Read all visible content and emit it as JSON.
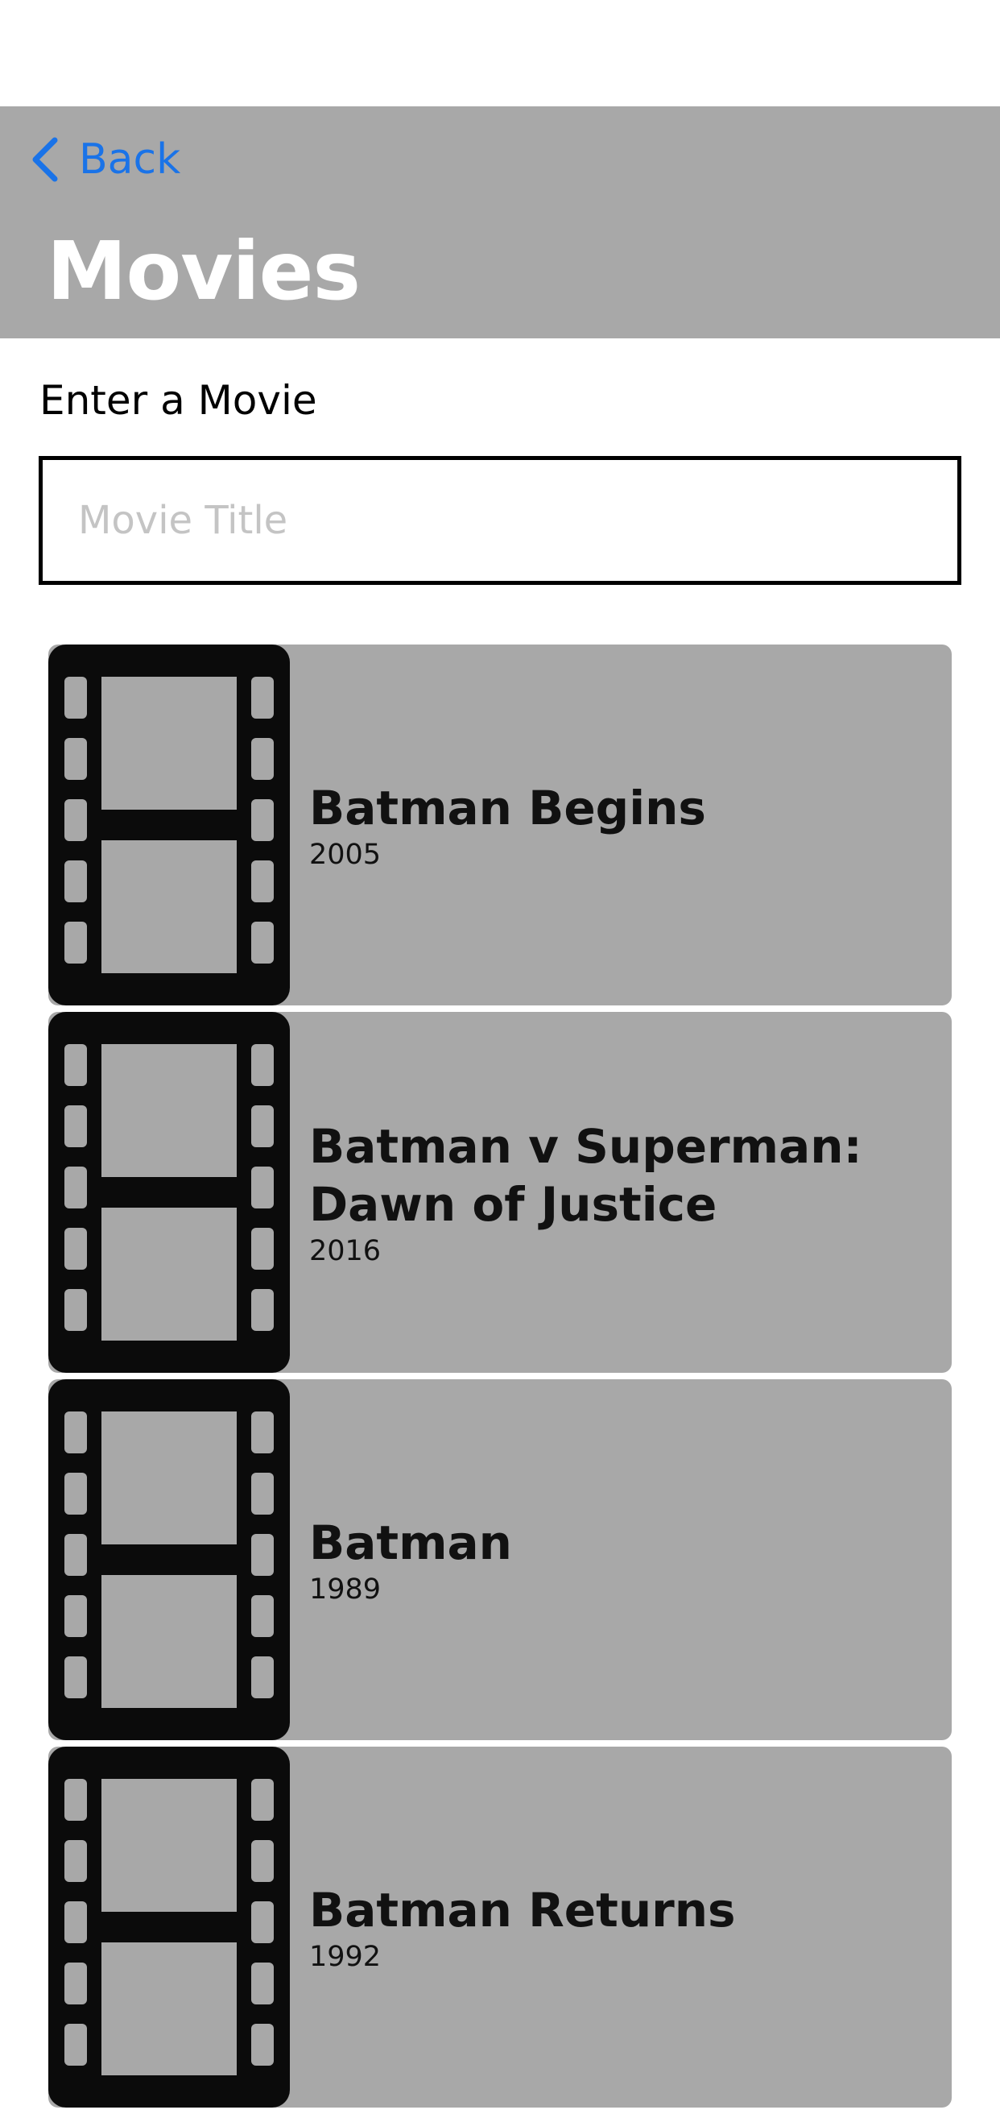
{
  "nav": {
    "back_label": "Back",
    "title": "Movies"
  },
  "search": {
    "label": "Enter a Movie",
    "placeholder": "Movie Title",
    "value": ""
  },
  "movies": [
    {
      "title": "Batman Begins",
      "year": "2005"
    },
    {
      "title": "Batman v Superman: Dawn of Justice",
      "year": "2016"
    },
    {
      "title": "Batman",
      "year": "1989"
    },
    {
      "title": "Batman Returns",
      "year": "1992"
    }
  ],
  "colors": {
    "navbar": "#a8a8a8",
    "accent": "#1a73e8",
    "row": "#a8a8a8"
  },
  "icons": {
    "back": "chevron-left-icon",
    "poster": "film-strip-icon"
  }
}
